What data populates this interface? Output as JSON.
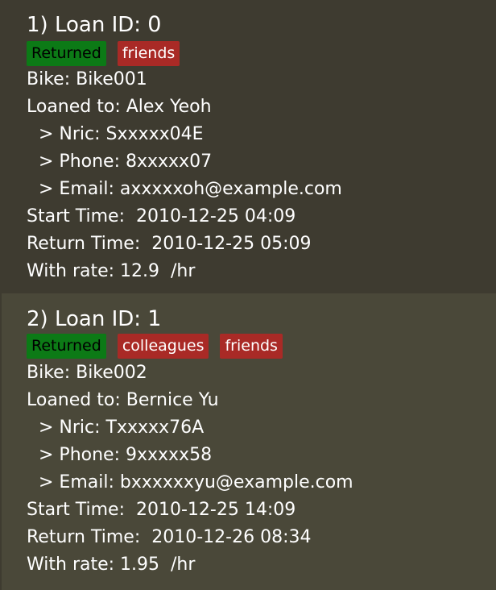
{
  "loans": [
    {
      "index": "1)",
      "title_prefix": "Loan ID:",
      "loan_id": "0",
      "status": "Returned",
      "tags": [
        "friends"
      ],
      "bike": "Bike: Bike001",
      "loaned_to": "Loaned to: Alex Yeoh",
      "nric": "> Nric: Sxxxxx04E",
      "phone": "> Phone: 8xxxxx07",
      "email": "> Email: axxxxxoh@example.com",
      "start_time": "Start Time:  2010-12-25 04:09",
      "return_time": "Return Time:  2010-12-25 05:09",
      "rate": "With rate: 12.9  /hr"
    },
    {
      "index": "2)",
      "title_prefix": "Loan ID:",
      "loan_id": "1",
      "status": "Returned",
      "tags": [
        "colleagues",
        "friends"
      ],
      "bike": "Bike: Bike002",
      "loaned_to": "Loaned to: Bernice Yu",
      "nric": "> Nric: Txxxxx76A",
      "phone": "> Phone: 9xxxxx58",
      "email": "> Email: bxxxxxxyu@example.com",
      "start_time": "Start Time:  2010-12-25 14:09",
      "return_time": "Return Time:  2010-12-26 08:34",
      "rate": "With rate: 1.95  /hr"
    }
  ],
  "colors": {
    "card_odd_bg": "#3e3b30",
    "card_even_bg": "#4a4839",
    "status_tag_bg": "#0c7a16",
    "label_tag_bg": "#a92a26"
  }
}
